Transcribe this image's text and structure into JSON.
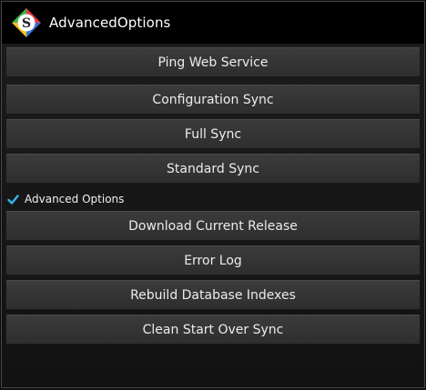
{
  "app": {
    "title": "AdvancedOptions",
    "icon": "app-logo-icon",
    "icon_letter": "S"
  },
  "buttons_top": [
    {
      "label": "Ping Web Service"
    },
    {
      "label": "Configuration Sync"
    },
    {
      "label": "Full Sync"
    },
    {
      "label": "Standard Sync"
    }
  ],
  "advanced_checkbox": {
    "label": "Advanced Options",
    "checked": true,
    "icon": "checkmark-icon"
  },
  "buttons_advanced": [
    {
      "label": "Download Current Release"
    },
    {
      "label": "Error Log"
    },
    {
      "label": "Rebuild Database Indexes"
    },
    {
      "label": "Clean Start Over Sync"
    }
  ],
  "colors": {
    "accent": "#33b5e5",
    "background": "#161616",
    "button": "#343434"
  }
}
